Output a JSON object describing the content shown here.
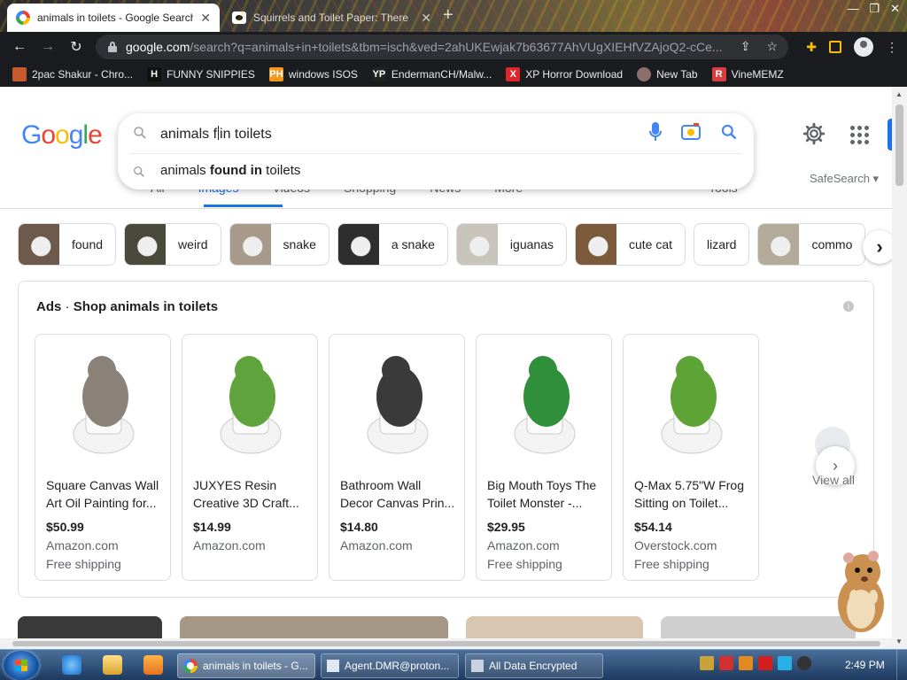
{
  "browser": {
    "tabs": [
      {
        "title": "animals in toilets - Google Search",
        "active": true
      },
      {
        "title": "Squirrels and Toilet Paper: There",
        "active": false
      }
    ],
    "url_host": "google.com",
    "url_rest": "/search?q=animals+in+toilets&tbm=isch&ved=2ahUKEwjak7b63677AhVUgXIEHfVZAjoQ2-cCe...",
    "bookmarks": [
      {
        "label": "2pac Shakur - Chro...",
        "icon": "bookmark-folder-icon",
        "color": "#c65a2e"
      },
      {
        "label": "FUNNY SNIPPIES",
        "icon": "H",
        "color": "#111111"
      },
      {
        "label": "windows ISOS",
        "icon": "PH",
        "color": "#f7971d"
      },
      {
        "label": "EndermanCH/Malw...",
        "icon": "YP",
        "color": "#222222"
      },
      {
        "label": "XP Horror Download",
        "icon": "X",
        "color": "#e0262c"
      },
      {
        "label": "New Tab",
        "icon": "globe-icon",
        "color": "#8a6f6a"
      },
      {
        "label": "VineMEMZ",
        "icon": "R",
        "color": "#d93d3d"
      }
    ]
  },
  "search": {
    "query_before": "animals f",
    "query_after": "in toilets",
    "suggestion_prefix": "animals ",
    "suggestion_bold": "found in",
    "suggestion_suffix": " toilets"
  },
  "tabs_row": {
    "items": [
      "All",
      "Images",
      "Videos",
      "Shopping",
      "News",
      "More"
    ],
    "active": "Images",
    "tools": "Tools",
    "safesearch": "SafeSearch"
  },
  "chips": [
    {
      "label": "found",
      "thumb": "#6d5a4a"
    },
    {
      "label": "weird",
      "thumb": "#4a4a3a"
    },
    {
      "label": "snake",
      "thumb": "#a89a8a"
    },
    {
      "label": "a snake",
      "thumb": "#2e2e2e"
    },
    {
      "label": "iguanas",
      "thumb": "#c8c4bc"
    },
    {
      "label": "cute cat",
      "thumb": "#7a5a3a"
    },
    {
      "label": "lizard",
      "thumb": ""
    },
    {
      "label": "commo",
      "thumb": "#b4aa9a"
    }
  ],
  "ads": {
    "prefix": "Ads",
    "title": "Shop animals in toilets",
    "products": [
      {
        "name": "Square Canvas Wall Art Oil Painting for...",
        "price": "$50.99",
        "store": "Amazon.com",
        "shipping": "Free shipping",
        "img": "#8a8278"
      },
      {
        "name": "JUXYES Resin Creative 3D Craft...",
        "price": "$14.99",
        "store": "Amazon.com",
        "shipping": "",
        "img": "#5fa33c"
      },
      {
        "name": "Bathroom Wall Decor Canvas Prin...",
        "price": "$14.80",
        "store": "Amazon.com",
        "shipping": "",
        "img": "#3a3a3a"
      },
      {
        "name": "Big Mouth Toys The Toilet Monster -...",
        "price": "$29.95",
        "store": "Amazon.com",
        "shipping": "Free shipping",
        "img": "#2f8f3a"
      },
      {
        "name": "Q-Max 5.75\"W Frog Sitting on Toilet...",
        "price": "$54.14",
        "store": "Overstock.com",
        "shipping": "Free shipping",
        "img": "#5ea336"
      }
    ],
    "view_all": "View all"
  },
  "taskbar": {
    "buttons": [
      {
        "label": "animals in toilets - G...",
        "active": true
      },
      {
        "label": "Agent.DMR@proton...",
        "active": false
      },
      {
        "label": "All Data Encrypted",
        "active": false
      }
    ],
    "clock": "2:49 PM"
  }
}
